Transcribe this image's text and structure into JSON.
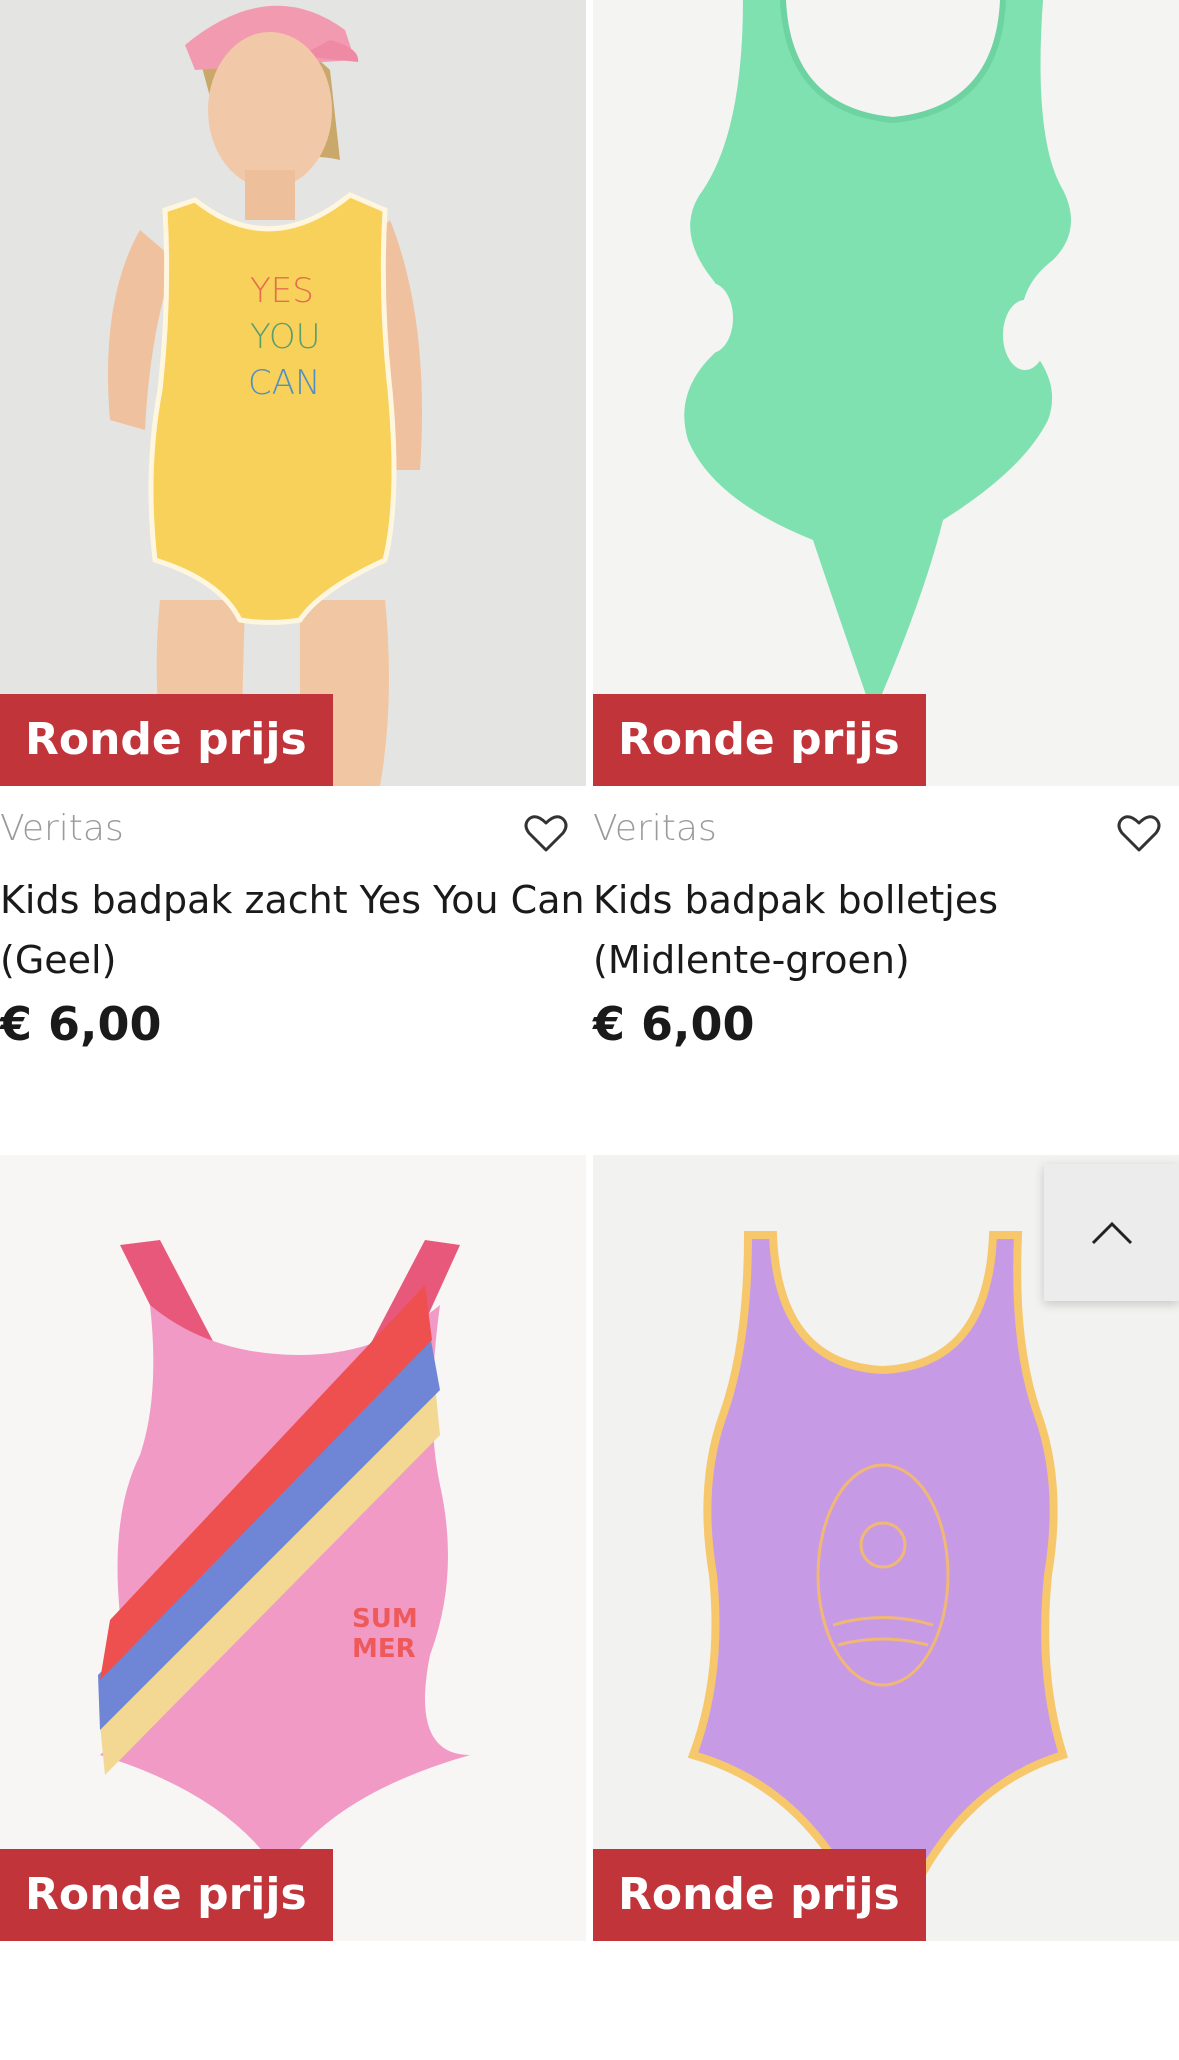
{
  "products": [
    {
      "badge": "Ronde prijs",
      "brand": "Veritas",
      "title": "Kids badpak zacht Yes You Can (Geel)",
      "price": "€ 6,00",
      "print_text": [
        "YES",
        "YOU",
        "CAN"
      ],
      "image": "girl-yellow-swimsuit"
    },
    {
      "badge": "Ronde prijs",
      "brand": "Veritas",
      "title": "Kids badpak bolletjes (Midlente-groen)",
      "price": "€ 6,00",
      "image": "green-cutout-swimsuit"
    },
    {
      "badge": "Ronde prijs",
      "print_text": [
        "SUM",
        "MER"
      ],
      "image": "pink-stripe-swimsuit"
    },
    {
      "badge": "Ronde prijs",
      "image": "lilac-swimsuit"
    }
  ],
  "icons": {
    "wishlist": "heart-icon",
    "scroll_top": "chevron-up-icon"
  },
  "colors": {
    "badge_bg": "#c0343a",
    "brand_text": "#9a9a9a"
  }
}
